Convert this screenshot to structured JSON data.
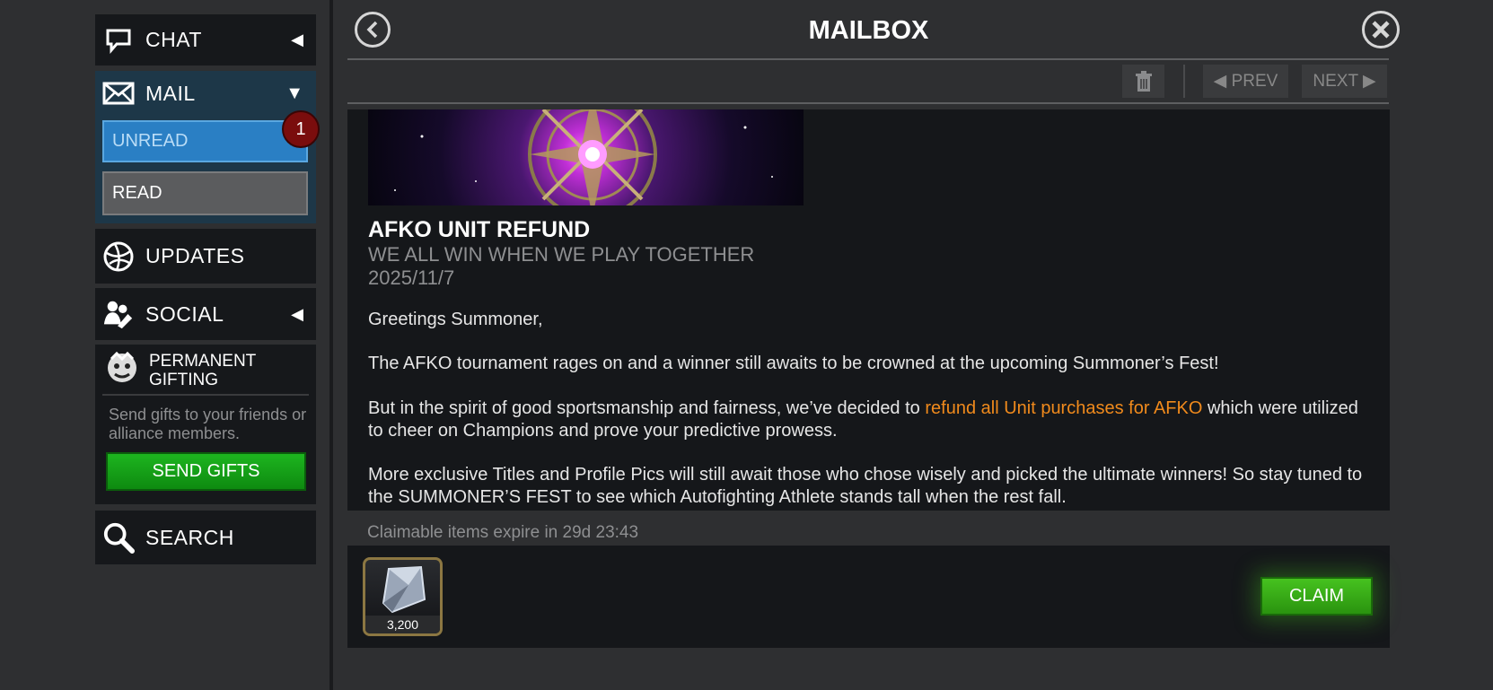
{
  "sidebar": {
    "chat": {
      "label": "CHAT"
    },
    "mail": {
      "label": "MAIL",
      "unread_label": "UNREAD",
      "unread_badge": "1",
      "read_label": "READ"
    },
    "updates": {
      "label": "UPDATES"
    },
    "social": {
      "label": "SOCIAL"
    },
    "gifting": {
      "title_line1": "PERMANENT",
      "title_line2": "GIFTING",
      "description": "Send gifts to your friends or alliance members.",
      "button_label": "SEND GIFTS"
    },
    "search": {
      "label": "SEARCH"
    }
  },
  "header": {
    "title": "MAILBOX"
  },
  "toolbar": {
    "prev_label": "◀ PREV",
    "next_label": "NEXT ▶"
  },
  "message": {
    "title": "AFKO UNIT REFUND",
    "subtitle": "WE ALL WIN WHEN WE PLAY TOGETHER",
    "date": "2025/11/7",
    "greeting": "Greetings Summoner,",
    "para1": "The AFKO tournament rages on and a winner still awaits to be crowned at the upcoming Summoner’s Fest!",
    "para2_before": "But in the spirit of good sportsmanship and fairness, we’ve decided to ",
    "para2_highlight": "refund all Unit purchases for AFKO",
    "para2_after": " which were utilized to cheer on Champions and prove your predictive prowess.",
    "para3": "More exclusive Titles and Profile Pics will still await those who chose wisely and picked the ultimate winners! So stay tuned to the SUMMONER’S FEST to see which Autofighting Athlete stands tall when the rest fall."
  },
  "claim": {
    "expire_text": "Claimable items expire in 29d 23:43",
    "item_count": "3,200",
    "button_label": "CLAIM"
  },
  "colors": {
    "accent_orange": "#f08a1c",
    "unread_blue": "#2a7fc4",
    "claim_green": "#3aa81a",
    "gift_green": "#16a01a"
  }
}
